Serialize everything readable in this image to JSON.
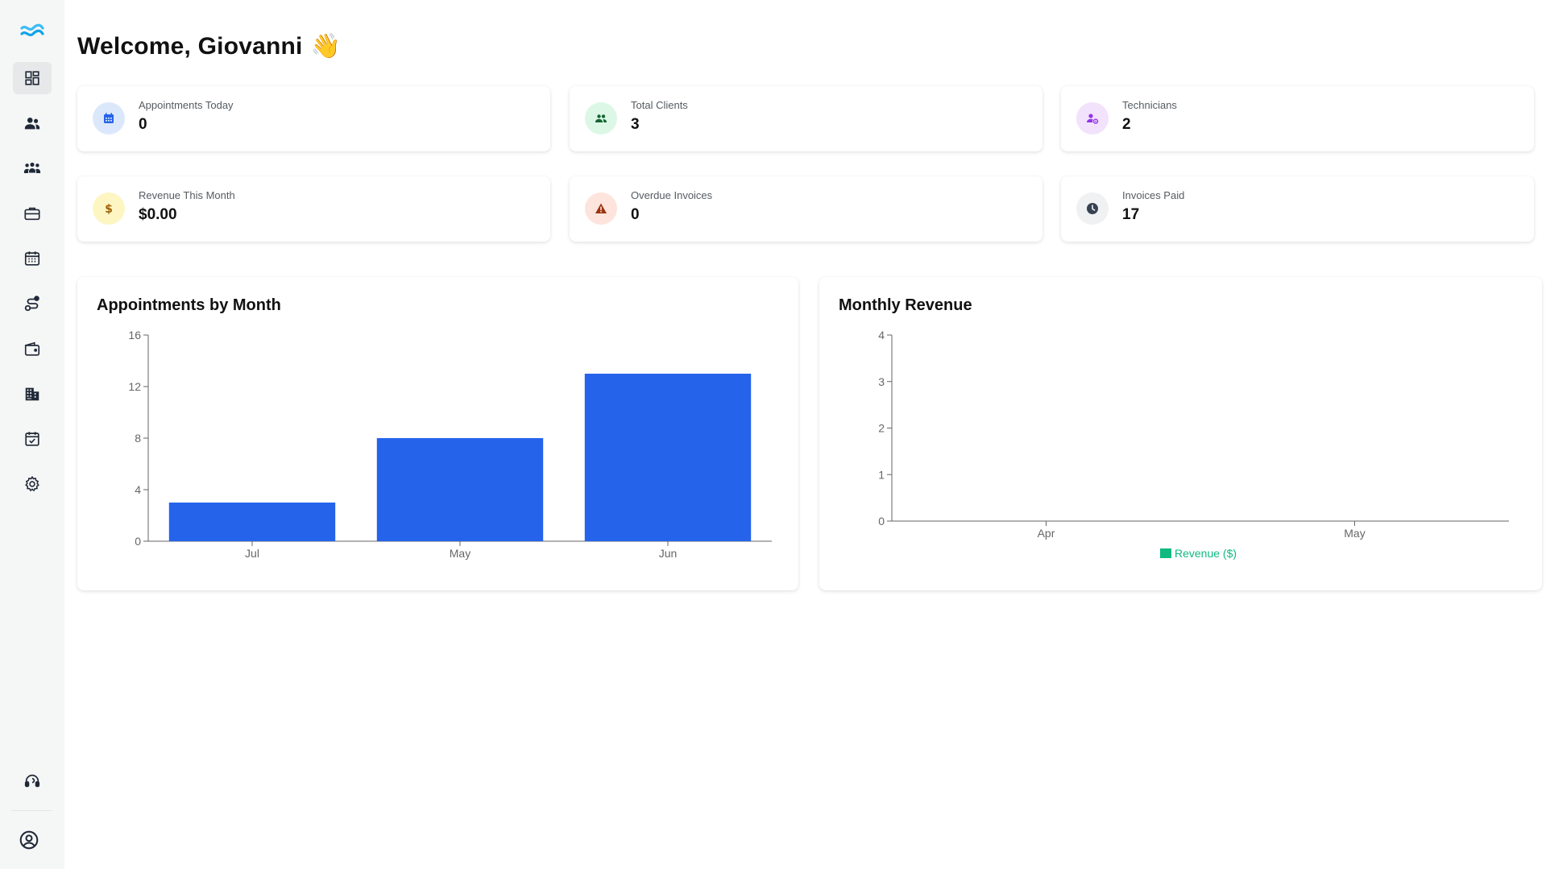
{
  "header": {
    "welcome_text": "Welcome, Giovanni",
    "wave_emoji": "👋"
  },
  "sidebar": {
    "items": [
      {
        "icon": "dashboard-icon",
        "active": true
      },
      {
        "icon": "users-icon"
      },
      {
        "icon": "groups-icon"
      },
      {
        "icon": "briefcase-icon"
      },
      {
        "icon": "calendar-icon"
      },
      {
        "icon": "route-icon"
      },
      {
        "icon": "wallet-icon"
      },
      {
        "icon": "building-icon"
      },
      {
        "icon": "calendar-check-icon"
      },
      {
        "icon": "gear-icon"
      }
    ],
    "bottom": [
      {
        "icon": "support-icon"
      },
      {
        "icon": "account-icon"
      }
    ]
  },
  "stats": [
    {
      "label": "Appointments Today",
      "value": "0",
      "icon": "calendar-icon",
      "bg": "#dbe8fc",
      "fg": "#2563eb"
    },
    {
      "label": "Total Clients",
      "value": "3",
      "icon": "users-icon",
      "bg": "#dcf7e6",
      "fg": "#15803d"
    },
    {
      "label": "Technicians",
      "value": "2",
      "icon": "user-gear-icon",
      "bg": "#f2e2fb",
      "fg": "#9333ea"
    },
    {
      "label": "Revenue This Month",
      "value": "$0.00",
      "icon": "dollar-icon",
      "bg": "#fdf6c3",
      "fg": "#a16207"
    },
    {
      "label": "Overdue Invoices",
      "value": "0",
      "icon": "warning-icon",
      "bg": "#fde4dc",
      "fg": "#9a3412"
    },
    {
      "label": "Invoices Paid",
      "value": "17",
      "icon": "clock-icon",
      "bg": "#f0f1f2",
      "fg": "#374151"
    }
  ],
  "charts": {
    "appointments_title": "Appointments by Month",
    "revenue_title": "Monthly Revenue"
  },
  "chart_data": [
    {
      "type": "bar",
      "title": "Appointments by Month",
      "categories": [
        "Jul",
        "May",
        "Jun"
      ],
      "values": [
        3,
        8,
        13
      ],
      "ylim": [
        0,
        16
      ],
      "yticks": [
        0,
        4,
        8,
        12,
        16
      ],
      "color": "#2563eb",
      "grid": false
    },
    {
      "type": "bar",
      "title": "Monthly Revenue",
      "categories": [
        "Apr",
        "May"
      ],
      "series": [
        {
          "name": "Revenue ($)",
          "values": [
            0,
            0
          ],
          "color": "#10b981"
        }
      ],
      "ylim": [
        0,
        4
      ],
      "yticks": [
        0,
        1,
        2,
        3,
        4
      ],
      "legend": "bottom",
      "grid": false
    }
  ]
}
